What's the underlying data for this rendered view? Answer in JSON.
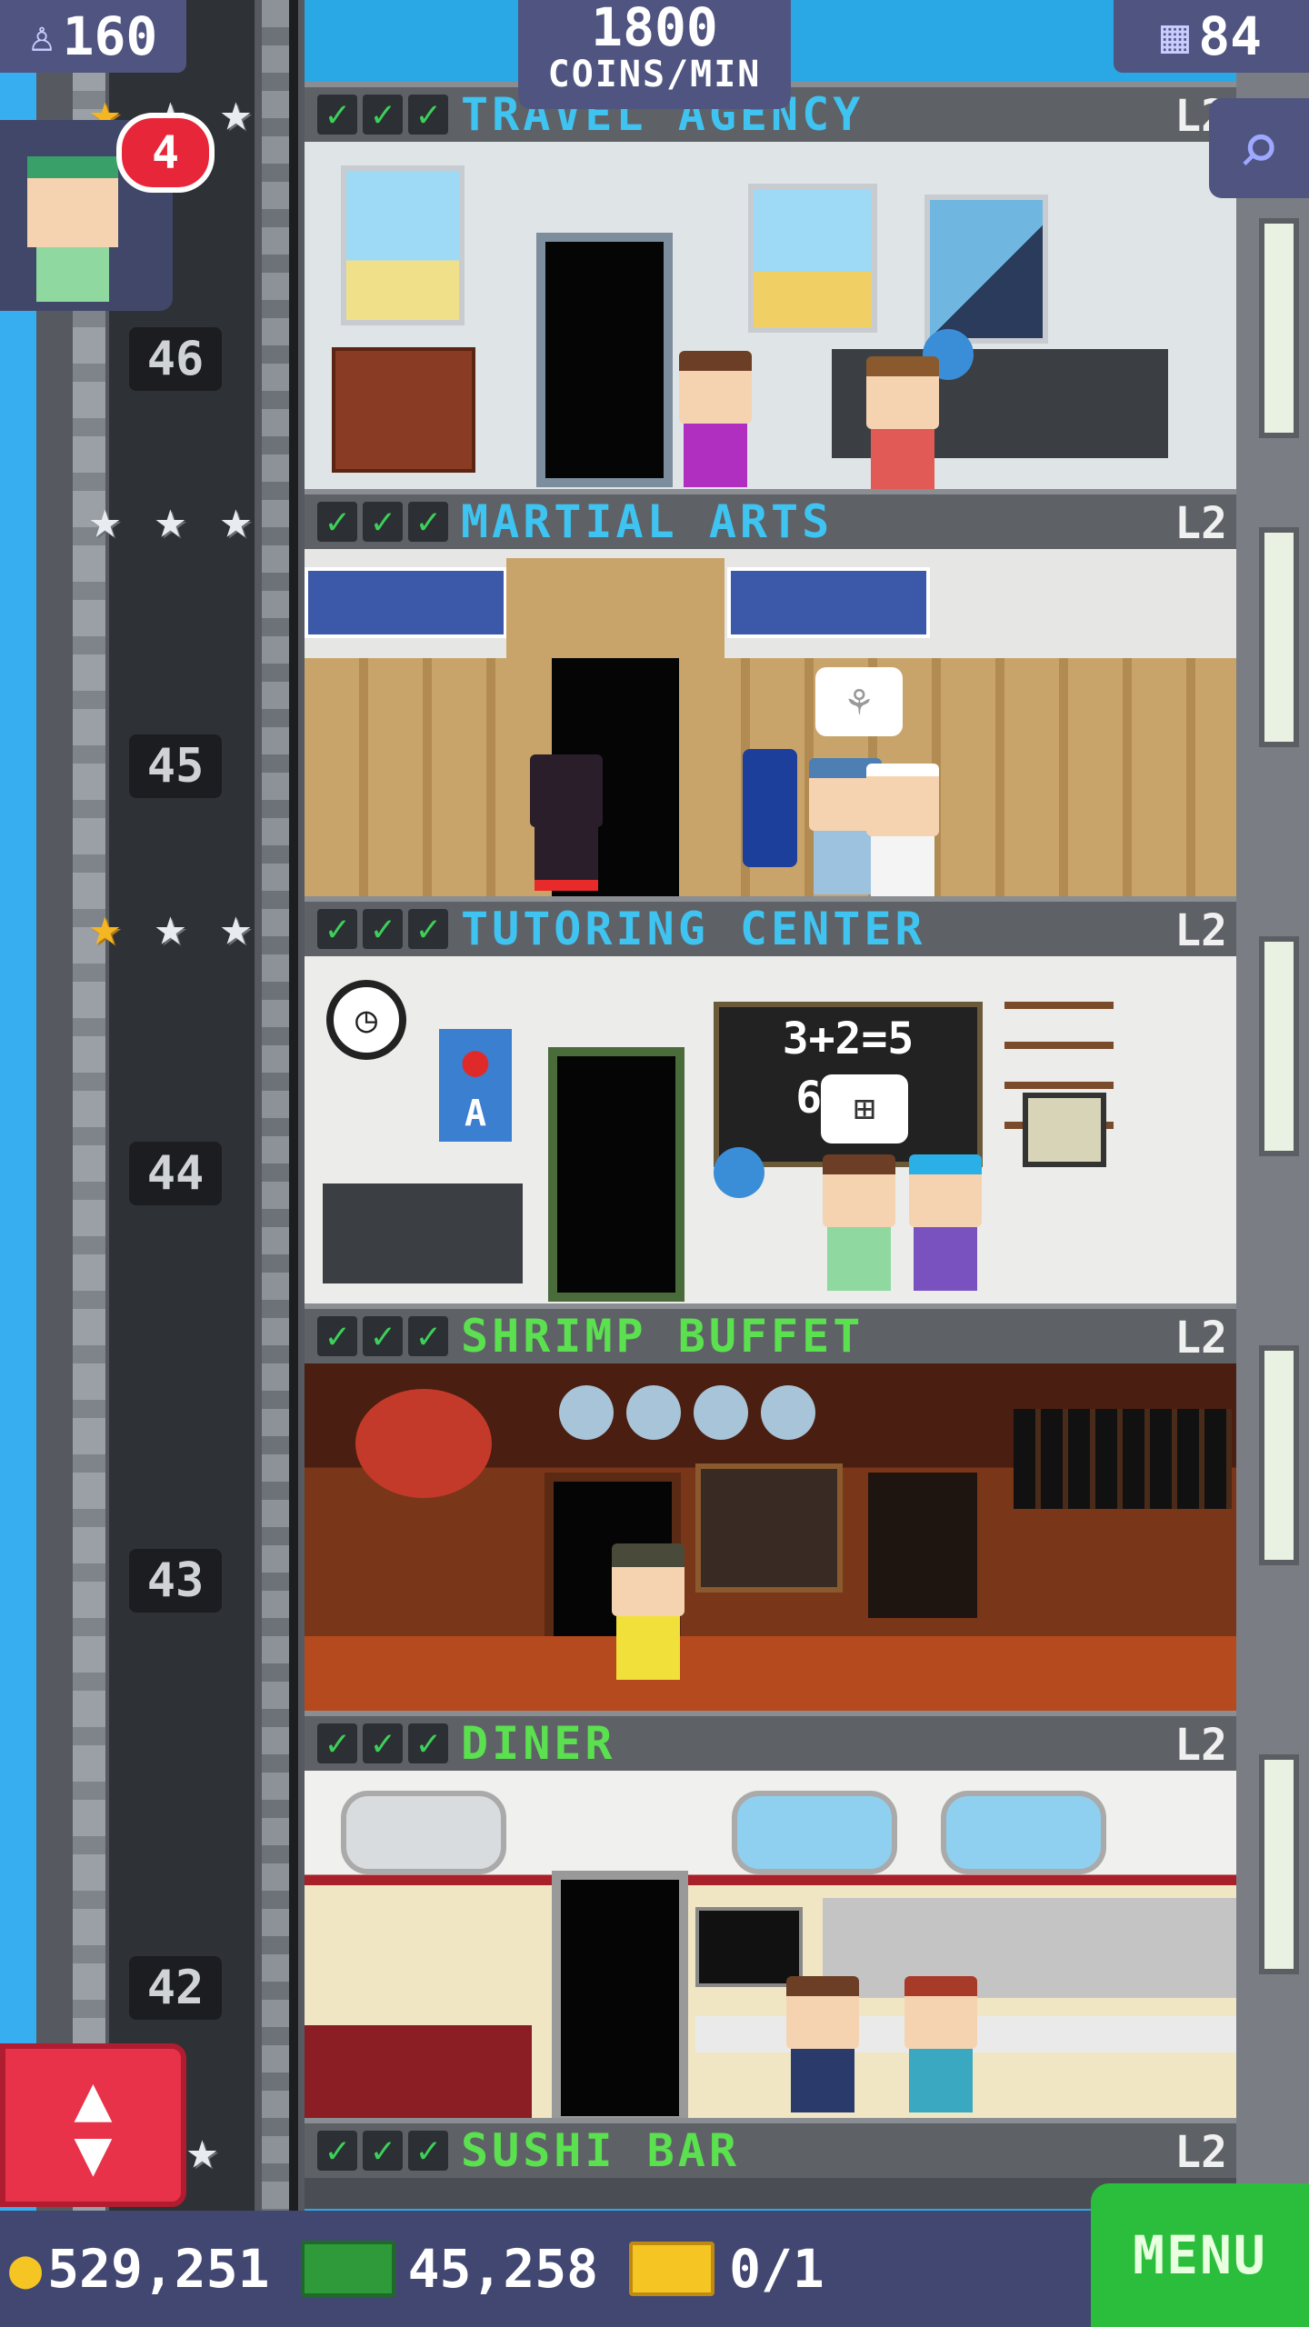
{
  "hud": {
    "population": "160",
    "coins_per_min_value": "1800",
    "coins_per_min_label": "COINS/MIN",
    "floors_count": "84",
    "visitor_count": "4"
  },
  "floors": [
    {
      "name": "TRAVEL AGENCY",
      "level": "L2",
      "color": "#3fc3f0",
      "number": "",
      "stars": [
        1,
        1,
        1
      ]
    },
    {
      "name": "MARTIAL ARTS",
      "level": "L2",
      "color": "#3fc3f0",
      "number": "46",
      "stars": [
        0,
        0,
        0
      ]
    },
    {
      "name": "TUTORING CENTER",
      "level": "L2",
      "color": "#3fc3f0",
      "number": "45",
      "stars": [
        1,
        0,
        0
      ]
    },
    {
      "name": "SHRIMP BUFFET",
      "level": "L2",
      "color": "#5be04f",
      "number": "44",
      "stars": []
    },
    {
      "name": "DINER",
      "level": "L2",
      "color": "#5be04f",
      "number": "43",
      "stars": []
    },
    {
      "name": "SUSHI BAR",
      "level": "L2",
      "color": "#5be04f",
      "number": "42",
      "stars": []
    }
  ],
  "rooms": {
    "tutoring_board_text": "3+2=5",
    "tutoring_board_text2": "6×  6",
    "tutoring_poster_letter": "A"
  },
  "bottom": {
    "coins": "529,251",
    "bux": "45,258",
    "tickets": "0/1",
    "menu_label": "MENU"
  },
  "colors": {
    "hud_bg": "#4f5580",
    "menu_green": "#2bbd3c",
    "elevator_button_red": "#e8324a",
    "service_cyan": "#3fc3f0",
    "food_green": "#5be04f"
  }
}
